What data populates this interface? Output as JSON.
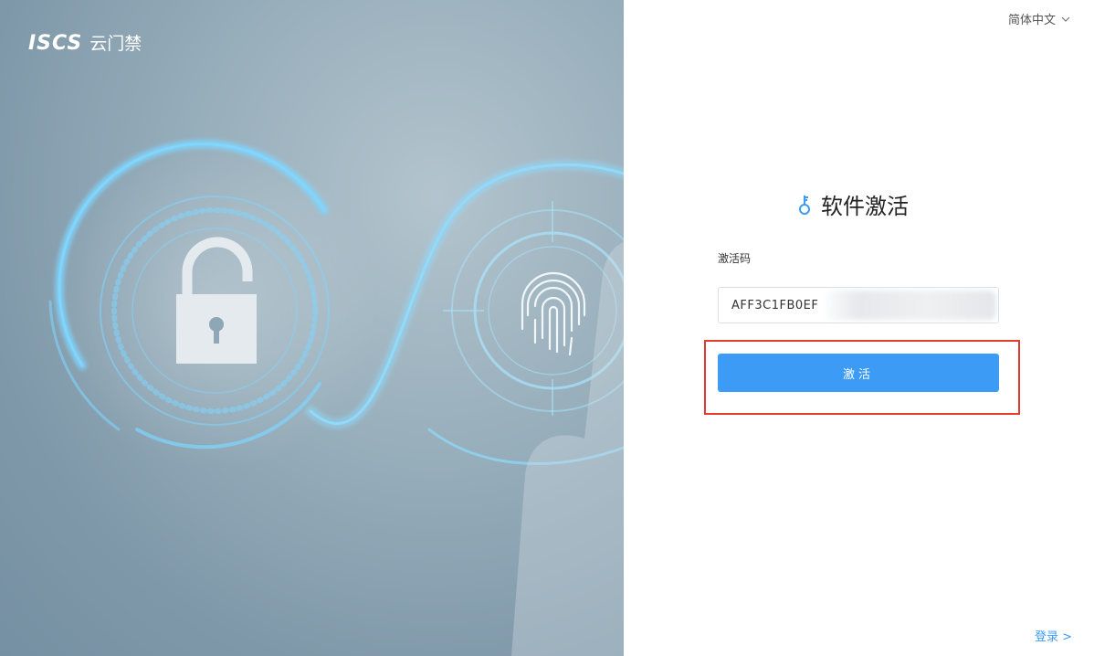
{
  "brand": {
    "mark": "ISCS",
    "name": "云门禁"
  },
  "language": {
    "selected": "简体中文"
  },
  "activation": {
    "title": "软件激活",
    "code_label": "激活码",
    "code_value": "AFF3C1FB0EF",
    "button_label": "激活"
  },
  "footer": {
    "login_link": "登录 >"
  },
  "colors": {
    "accent": "#3c9cf5",
    "highlight": "#e43a2f",
    "art_glow": "#6fd0ff"
  },
  "icons": [
    "padlock-icon",
    "fingerprint-icon",
    "key-icon",
    "chevron-down-icon"
  ]
}
